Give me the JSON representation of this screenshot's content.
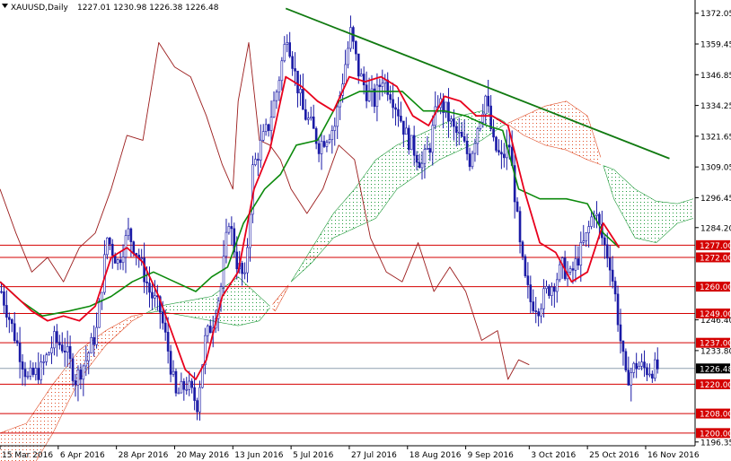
{
  "header": {
    "symbol": "XAUUSD,Daily",
    "ohlc": "1227.01 1230.98 1226.38 1226.48"
  },
  "colors": {
    "background": "#ffffff",
    "candle": "#1a1aa6",
    "tenkan": "#e8001c",
    "kijun": "#0c8a0c",
    "chikou": "#9b1c1c",
    "cloud_bull": "#1f9a3a",
    "cloud_bear": "#e0502a",
    "trendline": "#117a11",
    "level_line": "#d40000",
    "level_label_bg": "#d40000",
    "current_price_line": "#8fa0b0"
  },
  "chart_data": {
    "type": "candlestick",
    "title": "XAUUSD,Daily",
    "x_tick_labels": [
      "15 Mar 2016",
      "6 Apr 2016",
      "28 Apr 2016",
      "20 May 2016",
      "13 Jun 2016",
      "5 Jul 2016",
      "27 Jul 2016",
      "18 Aug 2016",
      "9 Sep 2016",
      "3 Oct 2016",
      "25 Oct 2016",
      "16 Nov 2016"
    ],
    "x_tick_days": [
      0,
      22,
      44,
      66,
      88,
      110,
      132,
      154,
      176,
      200,
      222,
      244
    ],
    "y_tick_labels": [
      "1372.05",
      "1359.45",
      "1346.85",
      "1334.25",
      "1321.65",
      "1309.05",
      "1296.45",
      "1284.20",
      "1246.40",
      "1233.80",
      "1196.35"
    ],
    "y_tick_values": [
      1372.05,
      1359.45,
      1346.85,
      1334.25,
      1321.65,
      1309.05,
      1296.45,
      1284.2,
      1246.4,
      1233.8,
      1196.35
    ],
    "ylim": [
      1194.8,
      1376.0
    ],
    "xlim_days": [
      0,
      262
    ],
    "last_close_day": 248,
    "current_price": {
      "label": "1226.48",
      "value": 1226.48
    },
    "horizontal_levels": [
      {
        "label": "1277.00",
        "value": 1277.0
      },
      {
        "label": "1272.00",
        "value": 1272.0
      },
      {
        "label": "1260.00",
        "value": 1260.0
      },
      {
        "label": "1249.00",
        "value": 1249.0
      },
      {
        "label": "1237.00",
        "value": 1237.0
      },
      {
        "label": "1220.00",
        "value": 1220.0
      },
      {
        "label": "1208.00",
        "value": 1208.0
      },
      {
        "label": "1200.00",
        "value": 1200.0
      }
    ],
    "trendline": {
      "start": [
        108,
        1374.0
      ],
      "end": [
        253,
        1312.5
      ]
    },
    "candles_close_path": [
      [
        0,
        1258
      ],
      [
        5,
        1240
      ],
      [
        10,
        1222
      ],
      [
        15,
        1226
      ],
      [
        20,
        1238
      ],
      [
        24,
        1235
      ],
      [
        28,
        1222
      ],
      [
        32,
        1230
      ],
      [
        36,
        1242
      ],
      [
        40,
        1280
      ],
      [
        44,
        1270
      ],
      [
        48,
        1282
      ],
      [
        52,
        1272
      ],
      [
        56,
        1258
      ],
      [
        60,
        1250
      ],
      [
        63,
        1234
      ],
      [
        66,
        1215
      ],
      [
        70,
        1220
      ],
      [
        74,
        1212
      ],
      [
        77,
        1238
      ],
      [
        80,
        1246
      ],
      [
        83,
        1260
      ],
      [
        86,
        1288
      ],
      [
        89,
        1270
      ],
      [
        92,
        1262
      ],
      [
        95,
        1308
      ],
      [
        98,
        1318
      ],
      [
        101,
        1326
      ],
      [
        104,
        1340
      ],
      [
        108,
        1364
      ],
      [
        111,
        1347
      ],
      [
        114,
        1332
      ],
      [
        117,
        1326
      ],
      [
        120,
        1318
      ],
      [
        123,
        1322
      ],
      [
        126,
        1326
      ],
      [
        129,
        1345
      ],
      [
        132,
        1364
      ],
      [
        135,
        1348
      ],
      [
        138,
        1340
      ],
      [
        141,
        1336
      ],
      [
        144,
        1346
      ],
      [
        147,
        1340
      ],
      [
        150,
        1332
      ],
      [
        153,
        1322
      ],
      [
        156,
        1316
      ],
      [
        159,
        1310
      ],
      [
        162,
        1318
      ],
      [
        165,
        1336
      ],
      [
        168,
        1332
      ],
      [
        171,
        1324
      ],
      [
        174,
        1320
      ],
      [
        177,
        1312
      ],
      [
        180,
        1326
      ],
      [
        183,
        1338
      ],
      [
        186,
        1318
      ],
      [
        189,
        1312
      ],
      [
        192,
        1318
      ],
      [
        194,
        1298
      ],
      [
        196,
        1276
      ],
      [
        198,
        1262
      ],
      [
        200,
        1254
      ],
      [
        203,
        1252
      ],
      [
        206,
        1258
      ],
      [
        209,
        1262
      ],
      [
        212,
        1268
      ],
      [
        215,
        1264
      ],
      [
        218,
        1272
      ],
      [
        221,
        1280
      ],
      [
        224,
        1292
      ],
      [
        227,
        1280
      ],
      [
        230,
        1270
      ],
      [
        232,
        1256
      ],
      [
        234,
        1238
      ],
      [
        236,
        1222
      ],
      [
        240,
        1228
      ],
      [
        244,
        1226
      ],
      [
        248,
        1226.48
      ]
    ],
    "tenkan_sen": [
      [
        0,
        1262
      ],
      [
        6,
        1256
      ],
      [
        12,
        1250
      ],
      [
        18,
        1246
      ],
      [
        24,
        1248
      ],
      [
        30,
        1246
      ],
      [
        36,
        1252
      ],
      [
        42,
        1272
      ],
      [
        48,
        1276
      ],
      [
        54,
        1270
      ],
      [
        60,
        1256
      ],
      [
        66,
        1238
      ],
      [
        70,
        1226
      ],
      [
        74,
        1222
      ],
      [
        78,
        1230
      ],
      [
        84,
        1256
      ],
      [
        90,
        1266
      ],
      [
        96,
        1300
      ],
      [
        102,
        1316
      ],
      [
        108,
        1346
      ],
      [
        114,
        1342
      ],
      [
        120,
        1336
      ],
      [
        126,
        1332
      ],
      [
        132,
        1346
      ],
      [
        138,
        1344
      ],
      [
        144,
        1346
      ],
      [
        150,
        1342
      ],
      [
        156,
        1330
      ],
      [
        162,
        1326
      ],
      [
        168,
        1338
      ],
      [
        174,
        1336
      ],
      [
        180,
        1330
      ],
      [
        186,
        1330
      ],
      [
        192,
        1326
      ],
      [
        198,
        1300
      ],
      [
        204,
        1278
      ],
      [
        210,
        1274
      ],
      [
        216,
        1262
      ],
      [
        222,
        1266
      ],
      [
        228,
        1286
      ],
      [
        234,
        1276
      ]
    ],
    "kijun_sen": [
      [
        0,
        1262
      ],
      [
        8,
        1254
      ],
      [
        16,
        1248
      ],
      [
        26,
        1250
      ],
      [
        34,
        1252
      ],
      [
        42,
        1256
      ],
      [
        50,
        1262
      ],
      [
        58,
        1266
      ],
      [
        66,
        1262
      ],
      [
        74,
        1258
      ],
      [
        80,
        1264
      ],
      [
        86,
        1268
      ],
      [
        92,
        1286
      ],
      [
        100,
        1300
      ],
      [
        106,
        1306
      ],
      [
        112,
        1318
      ],
      [
        120,
        1320
      ],
      [
        128,
        1336
      ],
      [
        136,
        1340
      ],
      [
        144,
        1340
      ],
      [
        152,
        1340
      ],
      [
        160,
        1332
      ],
      [
        168,
        1332
      ],
      [
        176,
        1330
      ],
      [
        184,
        1326
      ],
      [
        190,
        1324
      ],
      [
        196,
        1300
      ],
      [
        204,
        1296
      ],
      [
        214,
        1296
      ],
      [
        222,
        1294
      ],
      [
        228,
        1282
      ],
      [
        234,
        1276
      ]
    ],
    "chikou_span": [
      [
        0,
        1300
      ],
      [
        6,
        1282
      ],
      [
        12,
        1266
      ],
      [
        18,
        1272
      ],
      [
        24,
        1262
      ],
      [
        30,
        1276
      ],
      [
        36,
        1282
      ],
      [
        42,
        1300
      ],
      [
        48,
        1322
      ],
      [
        54,
        1320
      ],
      [
        60,
        1360
      ],
      [
        66,
        1350
      ],
      [
        72,
        1346
      ],
      [
        78,
        1330
      ],
      [
        84,
        1310
      ],
      [
        88,
        1300
      ],
      [
        90,
        1336
      ],
      [
        94,
        1360
      ],
      [
        98,
        1320
      ],
      [
        102,
        1318
      ],
      [
        106,
        1312
      ],
      [
        110,
        1300
      ],
      [
        116,
        1290
      ],
      [
        122,
        1300
      ],
      [
        128,
        1318
      ],
      [
        134,
        1312
      ],
      [
        140,
        1280
      ],
      [
        146,
        1266
      ],
      [
        152,
        1262
      ],
      [
        158,
        1278
      ],
      [
        164,
        1258
      ],
      [
        170,
        1268
      ],
      [
        176,
        1258
      ],
      [
        182,
        1238
      ],
      [
        188,
        1242
      ],
      [
        192,
        1222
      ],
      [
        196,
        1230
      ],
      [
        200,
        1228
      ]
    ],
    "cloud_span_a": [
      [
        0,
        1180
      ],
      [
        10,
        1182
      ],
      [
        20,
        1200
      ],
      [
        30,
        1222
      ],
      [
        40,
        1236
      ],
      [
        50,
        1246
      ],
      [
        60,
        1252
      ],
      [
        70,
        1254
      ],
      [
        80,
        1256
      ],
      [
        90,
        1264
      ],
      [
        98,
        1256
      ],
      [
        104,
        1250
      ],
      [
        110,
        1262
      ],
      [
        118,
        1276
      ],
      [
        126,
        1290
      ],
      [
        134,
        1300
      ],
      [
        142,
        1312
      ],
      [
        150,
        1318
      ],
      [
        158,
        1322
      ],
      [
        166,
        1326
      ],
      [
        174,
        1330
      ],
      [
        182,
        1332
      ],
      [
        190,
        1328
      ],
      [
        198,
        1322
      ],
      [
        206,
        1318
      ],
      [
        214,
        1316
      ],
      [
        222,
        1312
      ],
      [
        232,
        1308
      ],
      [
        240,
        1300
      ],
      [
        248,
        1295
      ],
      [
        256,
        1294
      ],
      [
        262,
        1296
      ]
    ],
    "cloud_span_b": [
      [
        0,
        1200
      ],
      [
        10,
        1204
      ],
      [
        20,
        1220
      ],
      [
        30,
        1234
      ],
      [
        40,
        1242
      ],
      [
        50,
        1248
      ],
      [
        60,
        1250
      ],
      [
        70,
        1248
      ],
      [
        80,
        1246
      ],
      [
        90,
        1244
      ],
      [
        98,
        1246
      ],
      [
        104,
        1254
      ],
      [
        110,
        1262
      ],
      [
        118,
        1270
      ],
      [
        126,
        1280
      ],
      [
        134,
        1284
      ],
      [
        142,
        1288
      ],
      [
        150,
        1300
      ],
      [
        158,
        1306
      ],
      [
        166,
        1312
      ],
      [
        174,
        1316
      ],
      [
        182,
        1320
      ],
      [
        190,
        1326
      ],
      [
        198,
        1330
      ],
      [
        206,
        1334
      ],
      [
        214,
        1336
      ],
      [
        222,
        1330
      ],
      [
        232,
        1296
      ],
      [
        240,
        1280
      ],
      [
        248,
        1278
      ],
      [
        256,
        1286
      ],
      [
        262,
        1288
      ]
    ]
  }
}
